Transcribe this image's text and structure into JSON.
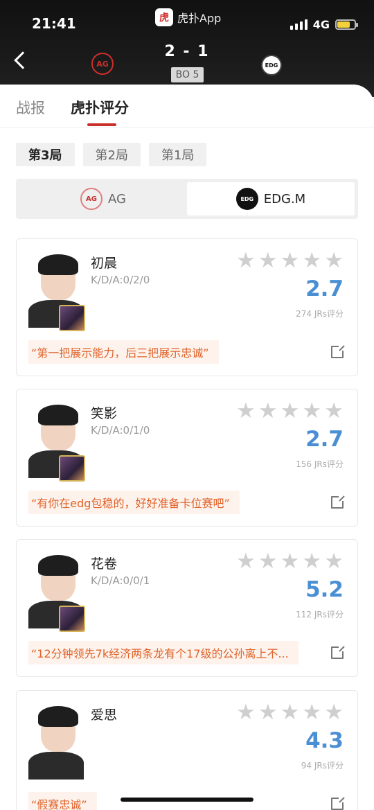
{
  "status_bar": {
    "time": "21:41",
    "network": "4G"
  },
  "app": {
    "logo_text": "虎",
    "name": "虎扑App"
  },
  "match": {
    "score": "2 - 1",
    "format": "BO 5",
    "team_a_logo": "AG",
    "team_b_logo": "EDG"
  },
  "tabs": [
    {
      "label": "战报"
    },
    {
      "label": "虎扑评分"
    }
  ],
  "games": [
    {
      "label": "第3局"
    },
    {
      "label": "第2局"
    },
    {
      "label": "第1局"
    }
  ],
  "teams": [
    {
      "label": "AG",
      "logo": "AG"
    },
    {
      "label": "EDG.M",
      "logo": "EDG"
    }
  ],
  "players": [
    {
      "name": "初晨",
      "kda": "K/D/A:0/2/0",
      "rating": "2.7",
      "count": "274 JRs评分",
      "quote": "“第一把展示能力，后三把展示忠诚”"
    },
    {
      "name": "笑影",
      "kda": "K/D/A:0/1/0",
      "rating": "2.7",
      "count": "156 JRs评分",
      "quote": "“有你在edg包稳的，好好准备卡位赛吧”"
    },
    {
      "name": "花卷",
      "kda": "K/D/A:0/0/1",
      "rating": "5.2",
      "count": "112 JRs评分",
      "quote": "“12分钟领先7k经济两条龙有个17级的公孙离上不..."
    },
    {
      "name": "爱思",
      "kda": "",
      "rating": "4.3",
      "count": "94 JRs评分",
      "quote": "“假赛忠诚”"
    }
  ],
  "colors": {
    "accent": "#c9302c",
    "rating": "#4a8fd4",
    "quote": "#e0622a"
  }
}
